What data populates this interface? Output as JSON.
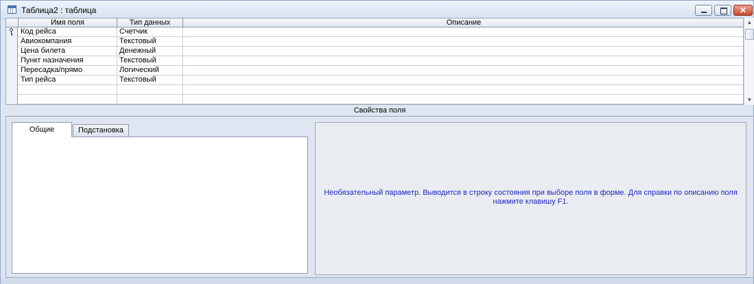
{
  "window": {
    "title": "Таблица2 : таблица",
    "close_glyph": "✕"
  },
  "grid": {
    "columns": [
      "Имя поля",
      "Тип данных",
      "Описание"
    ],
    "rows": [
      {
        "name": "Код рейса",
        "type": "Счетчик",
        "description": "",
        "primary_key": true
      },
      {
        "name": "Авиокомпания",
        "type": "Текстовый",
        "description": ""
      },
      {
        "name": "Цена билета",
        "type": "Денежный",
        "description": ""
      },
      {
        "name": "Пункт назначения",
        "type": "Текстовый",
        "description": ""
      },
      {
        "name": "Пересадка/прямо",
        "type": "Логический",
        "description": ""
      },
      {
        "name": "Тип рейса",
        "type": "Текстовый",
        "description": ""
      },
      {
        "name": "",
        "type": "",
        "description": ""
      },
      {
        "name": "",
        "type": "",
        "description": ""
      }
    ]
  },
  "properties": {
    "label": "Свойства поля",
    "tabs": [
      "Общие",
      "Подстановка"
    ],
    "help_text": "Необязательный параметр.  Выводится в строку состояния при выборе поля в форме.  Для справки по описанию поля нажмите клавишу F1."
  },
  "colors": {
    "help_text": "#1c27c4",
    "close_button": "#c94a2d"
  }
}
